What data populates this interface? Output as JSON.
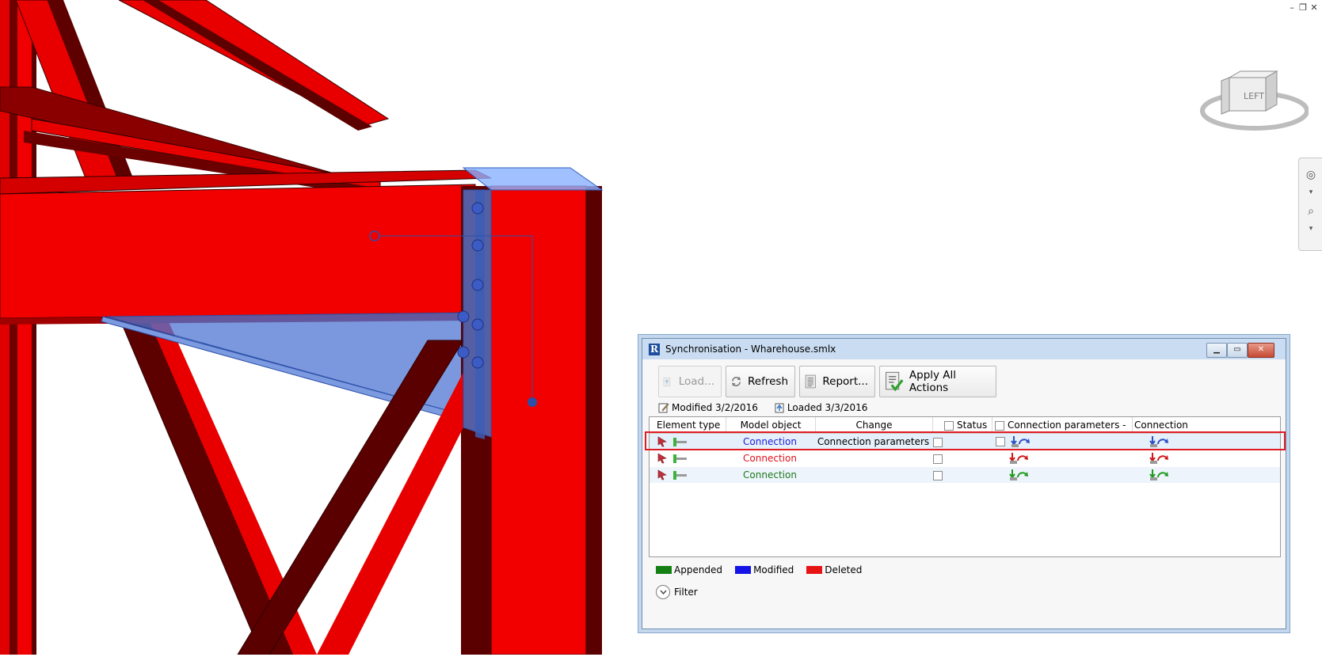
{
  "app": {
    "window_controls": [
      "minimize-icon",
      "restore-icon",
      "close-icon"
    ],
    "viewcube_face_label": "LEFT"
  },
  "dialog": {
    "title": "Synchronisation - Wharehouse.smlx",
    "toolbar": {
      "load_label": "Load...",
      "refresh_label": "Refresh",
      "report_label": "Report...",
      "apply_label": "Apply All Actions"
    },
    "info": {
      "modified": "Modified 3/2/2016",
      "loaded": "Loaded 3/3/2016"
    },
    "columns": {
      "element_type": "Element type",
      "model_object": "Model object",
      "change": "Change",
      "status": "Status",
      "conn_params_file": "Connection parameters - File",
      "conn_params": "Connection parameters"
    },
    "rows": [
      {
        "model_object": "Connection",
        "change": "Connection parameters",
        "state": "modified",
        "color": "#1a1adb"
      },
      {
        "model_object": "Connection",
        "change": "",
        "state": "deleted",
        "color": "#e0101a"
      },
      {
        "model_object": "Connection",
        "change": "",
        "state": "appended",
        "color": "#1a7a1a"
      }
    ],
    "legend": {
      "appended": "Appended",
      "modified": "Modified",
      "deleted": "Deleted",
      "appended_color": "#148014",
      "modified_color": "#1414e6",
      "deleted_color": "#e61414"
    },
    "filter_label": "Filter"
  }
}
